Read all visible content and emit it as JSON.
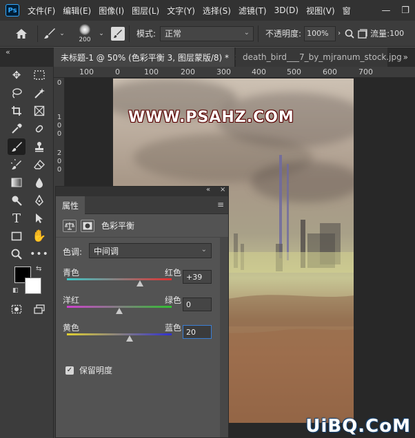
{
  "app": {
    "logo": "Ps",
    "menu": [
      "文件(F)",
      "编辑(E)",
      "图像(I)",
      "图层(L)",
      "文字(Y)",
      "选择(S)",
      "滤镜(T)",
      "3D(D)",
      "视图(V)",
      "窗"
    ],
    "window_controls": {
      "minimize": "—",
      "restore": "❐"
    }
  },
  "options_bar": {
    "brush_size": "200",
    "mode_label": "模式:",
    "mode_value": "正常",
    "opacity_label": "不透明度:",
    "opacity_value": "100%",
    "flow_label": "流量:",
    "flow_value": "100"
  },
  "tabs": [
    {
      "label": "未标题-1 @ 50% (色彩平衡 3, 图层蒙版/8) *",
      "close": "×"
    },
    {
      "label": "death_bird___7_by_mjranum_stock.jpg"
    }
  ],
  "tab_more": "»",
  "collapse": "«",
  "rulers": {
    "top": [
      "100",
      "0",
      "100",
      "200",
      "300",
      "400",
      "500",
      "600",
      "700"
    ],
    "left": [
      "0",
      "1",
      "0",
      "0",
      "2",
      "0",
      "0"
    ]
  },
  "canvas": {
    "watermark": "WWW.PSAHZ.COM"
  },
  "properties_panel": {
    "collapse": "«",
    "close": "×",
    "tab_label": "属性",
    "menu_icon": "≡",
    "header_title": "色彩平衡",
    "tone_label": "色调:",
    "tone_value": "中间调",
    "sliders": [
      {
        "left": "青色",
        "right": "红色",
        "value": "+39",
        "level": 39,
        "gradient_start": "#3cc8c8",
        "gradient_end": "#e03030"
      },
      {
        "left": "洋红",
        "right": "绿色",
        "value": "0",
        "level": 0,
        "gradient_start": "#d040d0",
        "gradient_end": "#30c030"
      },
      {
        "left": "黄色",
        "right": "蓝色",
        "value": "20",
        "level": 20,
        "gradient_start": "#e0d030",
        "gradient_end": "#3030d0"
      }
    ],
    "preserve_label": "保留明度",
    "preserve_checked": true
  },
  "site_watermark": "UiBQ.CoM"
}
